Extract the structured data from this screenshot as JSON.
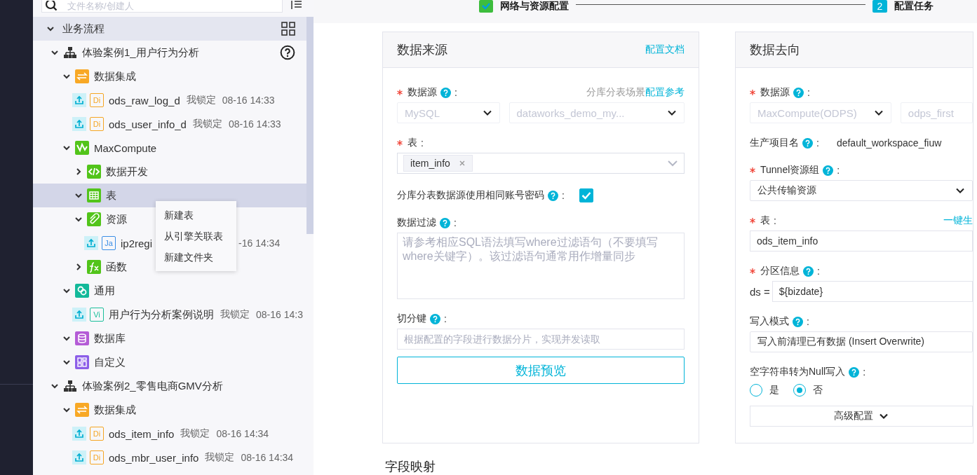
{
  "sidebar": {
    "search": {
      "placeholder": "文件名称/创建人"
    },
    "tree": [
      {
        "label": "业务流程",
        "kind": "root",
        "expanded": true,
        "selected": false,
        "children": [
          {
            "label": "体验案例1_用户行为分析",
            "kind": "workflow",
            "expanded": true,
            "selected": false,
            "show_help": true,
            "children": [
              {
                "label": "数据集成",
                "kind": "integration",
                "expanded": true,
                "selected": false,
                "children": [
                  {
                    "kind": "file",
                    "label": "ods_raw_log_d",
                    "badge": "Di",
                    "color": "#f5a623",
                    "lock": "我锁定",
                    "time": "08-16 14:33",
                    "selected": false
                  },
                  {
                    "kind": "file",
                    "label": "ods_user_info_d",
                    "badge": "Di",
                    "color": "#f5a623",
                    "lock": "我锁定",
                    "time": "08-16 14:33",
                    "selected": false
                  }
                ]
              },
              {
                "label": "MaxCompute",
                "kind": "maxcompute",
                "expanded": true,
                "selected": false,
                "children": [
                  {
                    "label": "数据开发",
                    "kind": "code",
                    "expanded": false,
                    "selected": false
                  },
                  {
                    "label": "表",
                    "kind": "table",
                    "expanded": true,
                    "selected": true
                  },
                  {
                    "label": "资源",
                    "kind": "resource",
                    "expanded": true,
                    "selected": false,
                    "children": [
                      {
                        "kind": "file",
                        "label": "ip2regi",
                        "badge": "Ja",
                        "color": "#3a8ee6",
                        "time": "-16 14:34",
                        "selected": false
                      }
                    ]
                  },
                  {
                    "label": "函数",
                    "kind": "function",
                    "expanded": false,
                    "selected": false
                  }
                ]
              },
              {
                "label": "通用",
                "kind": "general",
                "expanded": true,
                "selected": false,
                "children": [
                  {
                    "kind": "file",
                    "label": "用户行为分析案例说明",
                    "badge": "Vi",
                    "color": "#1bbf9b",
                    "lock": "我锁定",
                    "time": "08-16 14:3",
                    "selected": false
                  }
                ]
              },
              {
                "label": "数据库",
                "kind": "database",
                "expanded": true,
                "selected": false
              },
              {
                "label": "自定义",
                "kind": "custom",
                "expanded": true,
                "selected": false
              }
            ]
          },
          {
            "label": "体验案例2_零售电商GMV分析",
            "kind": "workflow",
            "expanded": true,
            "selected": false,
            "show_help": false,
            "children": [
              {
                "label": "数据集成",
                "kind": "integration",
                "expanded": true,
                "selected": false,
                "children": [
                  {
                    "kind": "file",
                    "label": "ods_item_info",
                    "badge": "Di",
                    "color": "#f5a623",
                    "lock": "我锁定",
                    "time": "08-16 14:34",
                    "selected": false
                  },
                  {
                    "kind": "file",
                    "label": "ods_mbr_user_info",
                    "badge": "Di",
                    "color": "#f5a623",
                    "lock": "我锁定",
                    "time": "08-16 14:34",
                    "selected": false
                  }
                ]
              }
            ]
          }
        ]
      }
    ],
    "context_menu": [
      "新建表",
      "从引擎关联表",
      "新建文件夹"
    ]
  },
  "steps": [
    {
      "label": "网络与资源配置",
      "done": true
    },
    {
      "label": "配置任务",
      "done": false,
      "number": "2"
    }
  ],
  "source": {
    "title": "数据来源",
    "header_link": "配置文档",
    "fields": [
      {
        "kind": "select_pair",
        "label": "数据源",
        "suffix": ":",
        "required": true,
        "help": true,
        "hint": "分库分表场景",
        "hint_link": "配置参考",
        "selects": [
          {
            "value": "MySQL",
            "disabled": true,
            "chevron": true
          },
          {
            "value": "dataworks_demo_my...",
            "disabled": true,
            "chevron": true
          }
        ]
      },
      {
        "kind": "tags",
        "label": "表",
        "suffix": ":",
        "required": true,
        "help": false,
        "tags": [
          "item_info"
        ]
      },
      {
        "kind": "checkbox",
        "label": "分库分表数据源使用相同账号密码",
        "suffix": ":",
        "required": false,
        "help": true,
        "checked": true
      },
      {
        "kind": "textarea",
        "label": "数据过滤",
        "suffix": ":",
        "required": false,
        "help": true,
        "placeholder": "请参考相应SQL语法填写where过滤语句（不要填写where关键字）。该过滤语句通常用作增量同步"
      },
      {
        "kind": "input",
        "label": "切分键",
        "suffix": ":",
        "required": false,
        "help": true,
        "placeholder": "根据配置的字段进行数据分片，实现并发读取"
      },
      {
        "kind": "button",
        "label": "数据预览"
      }
    ]
  },
  "target": {
    "title": "数据去向",
    "fields": [
      {
        "kind": "select_pair",
        "label": "数据源",
        "suffix": ":",
        "required": true,
        "help": true,
        "selects": [
          {
            "value": "MaxCompute(ODPS)",
            "disabled": true,
            "chevron": true
          },
          {
            "value": "odps_first",
            "disabled": true,
            "chevron": false
          }
        ]
      },
      {
        "kind": "readonly",
        "label": "生产项目名",
        "suffix": ":",
        "required": false,
        "help": true,
        "value": "default_workspace_fiuw"
      },
      {
        "kind": "select",
        "label": "Tunnel资源组",
        "suffix": ":",
        "required": true,
        "help": true,
        "value": "公共传输资源",
        "disabled": false,
        "chevron": true
      },
      {
        "kind": "input",
        "label": "表",
        "suffix": ":",
        "required": true,
        "help": false,
        "link": "一键生",
        "value": "ods_item_info"
      },
      {
        "kind": "input",
        "label": "分区信息",
        "suffix": ":",
        "required": true,
        "help": true,
        "prefix": "ds =",
        "value": "${bizdate}"
      },
      {
        "kind": "select",
        "label": "写入模式",
        "suffix": ":",
        "required": false,
        "help": true,
        "value": "写入前清理已有数据 (Insert Overwrite)",
        "disabled": false,
        "chevron": false
      },
      {
        "kind": "radio",
        "label": "空字符串转为Null写入",
        "suffix": ":",
        "required": false,
        "help": true,
        "options": [
          {
            "label": "是",
            "selected": false
          },
          {
            "label": "否",
            "selected": true
          }
        ]
      },
      {
        "kind": "expander",
        "label": "高级配置"
      }
    ]
  },
  "section_title": "字段映射"
}
